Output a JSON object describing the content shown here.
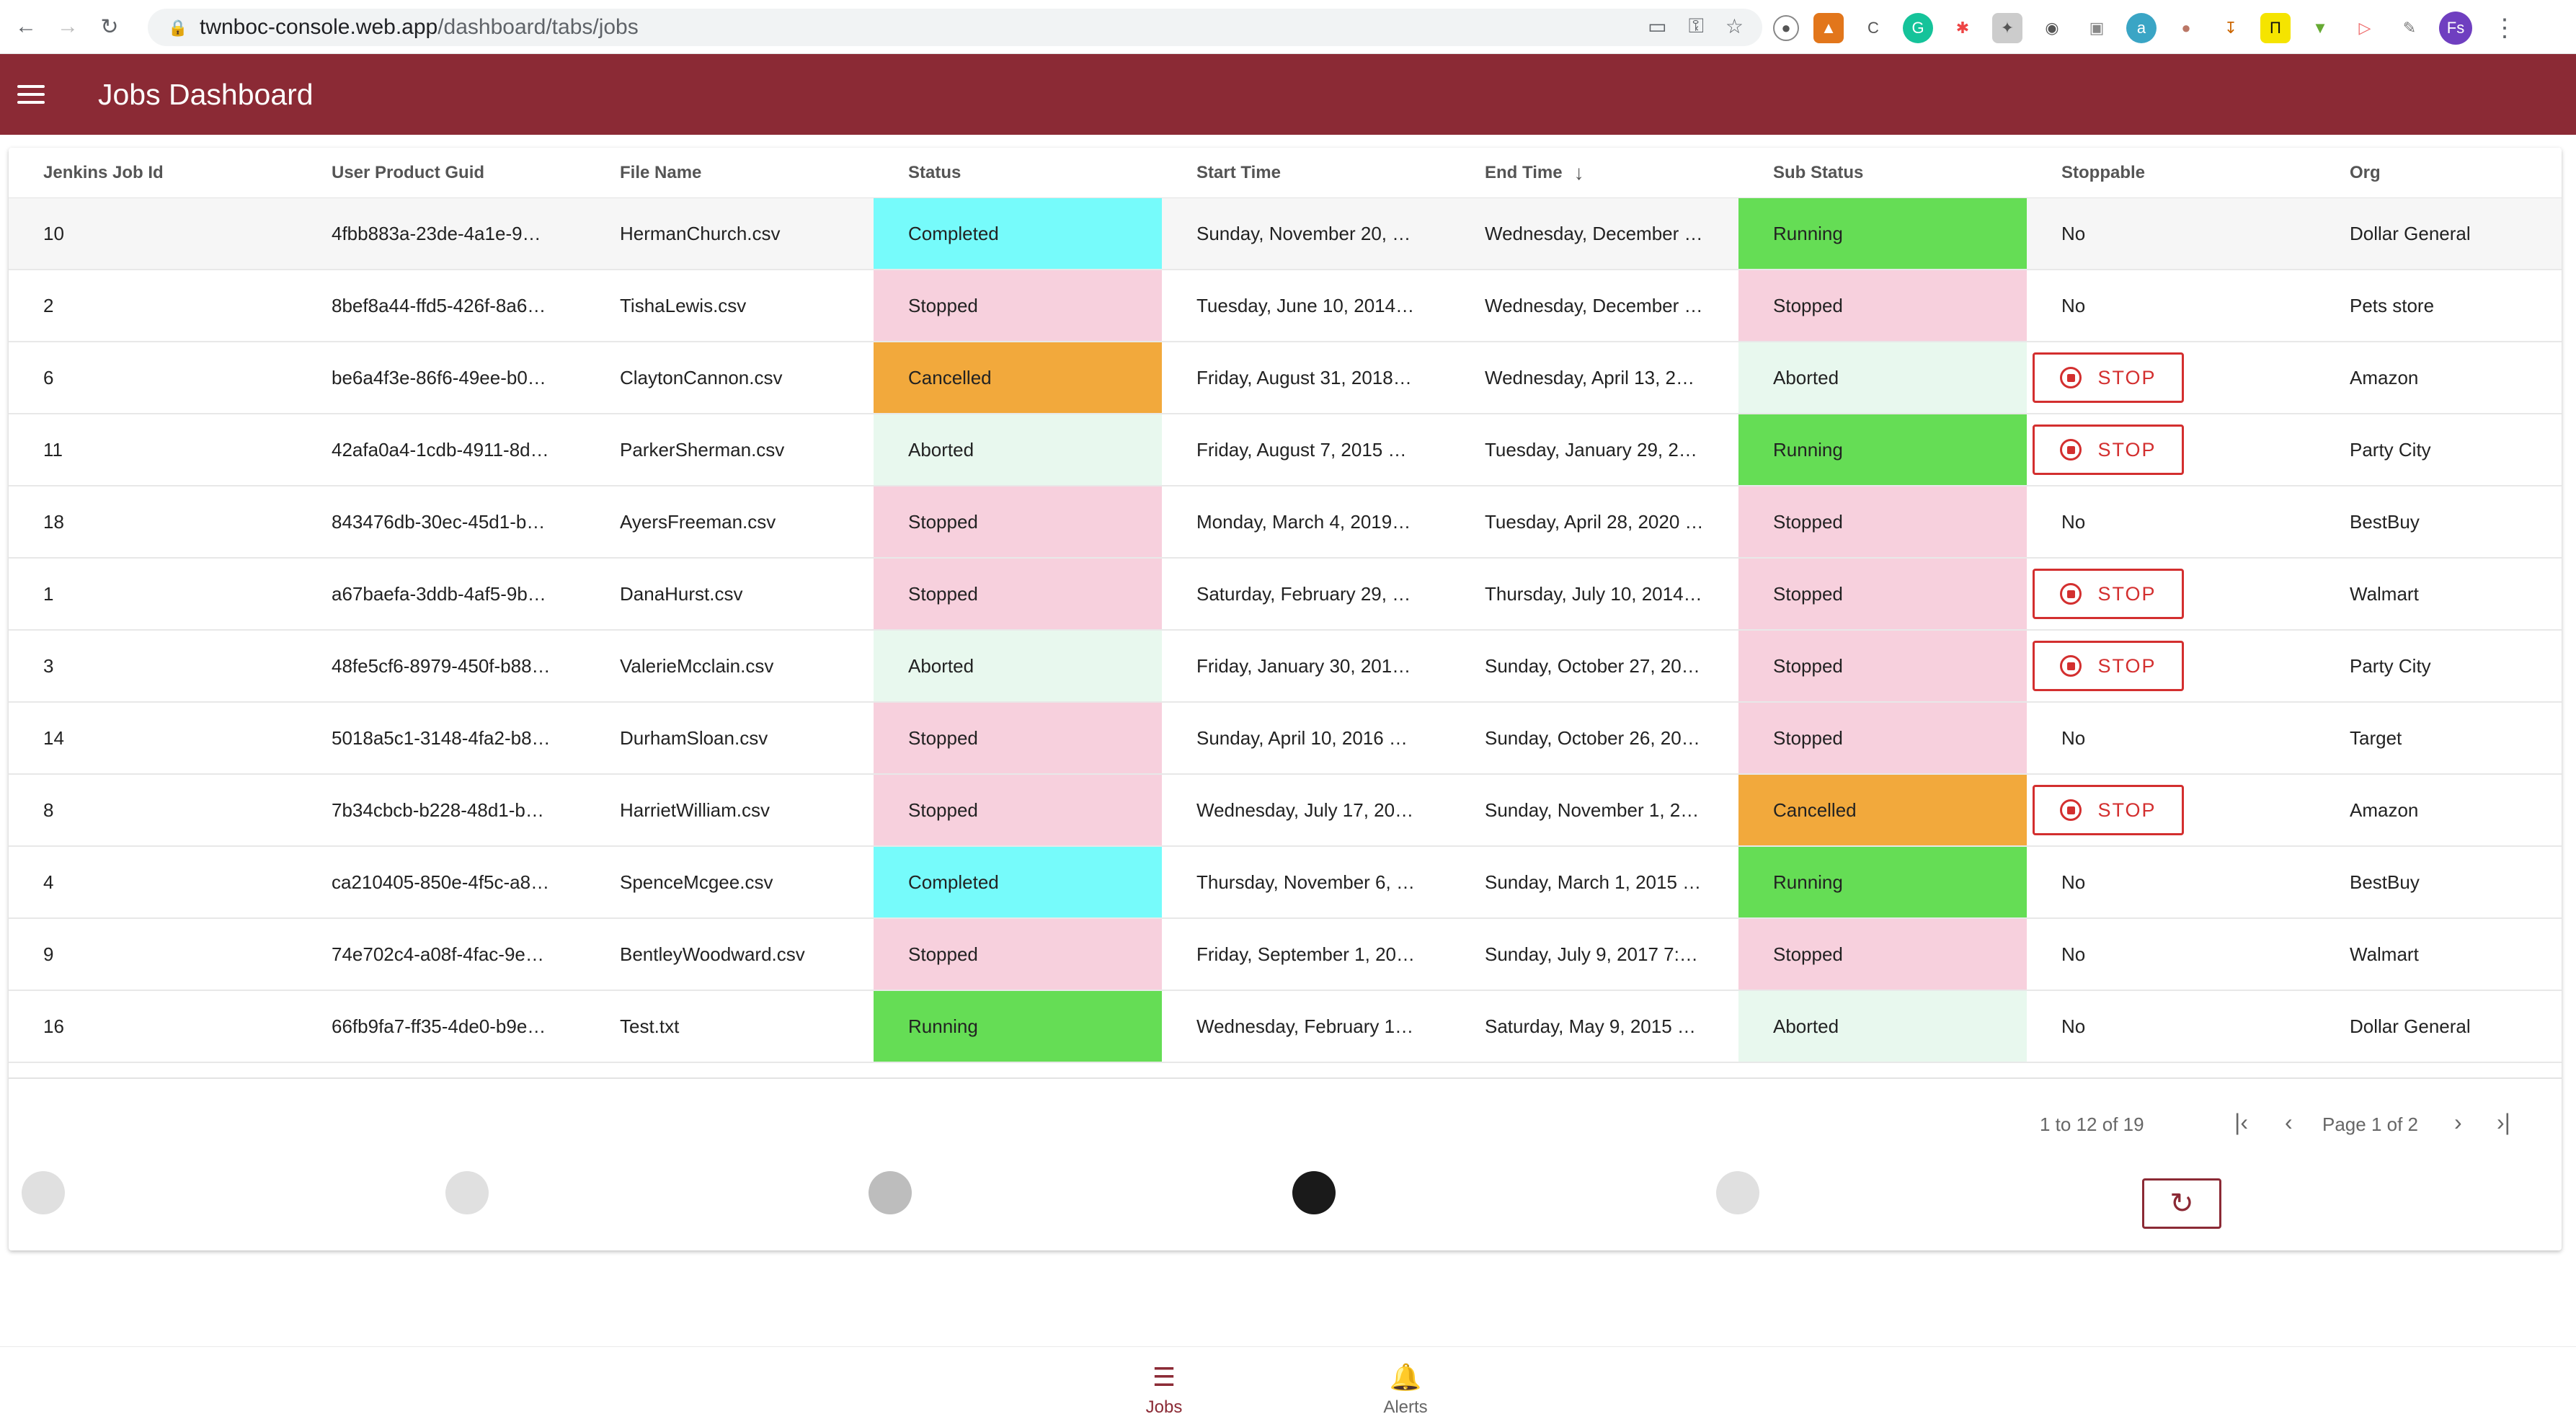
{
  "browser": {
    "url_host": "twnboc-console.web.app",
    "url_path": "/dashboard/tabs/jobs",
    "profile_initials": "Fs"
  },
  "header": {
    "title": "Jobs Dashboard"
  },
  "table": {
    "columns": [
      "Jenkins Job Id",
      "User Product Guid",
      "File Name",
      "Status",
      "Start Time",
      "End Time",
      "Sub Status",
      "Stoppable",
      "Org"
    ],
    "sorted_column": "End Time",
    "stop_label": "STOP",
    "rows": [
      {
        "id": "10",
        "guid": "4fbb883a-23de-4a1e-9…",
        "file": "HermanChurch.csv",
        "status": "Completed",
        "start": "Sunday, November 20, …",
        "end": "Wednesday, December …",
        "sub": "Running",
        "stoppable": "No",
        "org": "Dollar General"
      },
      {
        "id": "2",
        "guid": "8bef8a44-ffd5-426f-8a6…",
        "file": "TishaLewis.csv",
        "status": "Stopped",
        "start": "Tuesday, June 10, 2014…",
        "end": "Wednesday, December …",
        "sub": "Stopped",
        "stoppable": "No",
        "org": "Pets store"
      },
      {
        "id": "6",
        "guid": "be6a4f3e-86f6-49ee-b0…",
        "file": "ClaytonCannon.csv",
        "status": "Cancelled",
        "start": "Friday, August 31, 2018…",
        "end": "Wednesday, April 13, 2…",
        "sub": "Aborted",
        "stoppable": "STOP",
        "org": "Amazon"
      },
      {
        "id": "11",
        "guid": "42afa0a4-1cdb-4911-8d…",
        "file": "ParkerSherman.csv",
        "status": "Aborted",
        "start": "Friday, August 7, 2015 …",
        "end": "Tuesday, January 29, 2…",
        "sub": "Running",
        "stoppable": "STOP",
        "org": "Party City"
      },
      {
        "id": "18",
        "guid": "843476db-30ec-45d1-b…",
        "file": "AyersFreeman.csv",
        "status": "Stopped",
        "start": "Monday, March 4, 2019…",
        "end": "Tuesday, April 28, 2020 …",
        "sub": "Stopped",
        "stoppable": "No",
        "org": "BestBuy"
      },
      {
        "id": "1",
        "guid": "a67baefa-3ddb-4af5-9b…",
        "file": "DanaHurst.csv",
        "status": "Stopped",
        "start": "Saturday, February 29, …",
        "end": "Thursday, July 10, 2014…",
        "sub": "Stopped",
        "stoppable": "STOP",
        "org": "Walmart"
      },
      {
        "id": "3",
        "guid": "48fe5cf6-8979-450f-b88…",
        "file": "ValerieMcclain.csv",
        "status": "Aborted",
        "start": "Friday, January 30, 201…",
        "end": "Sunday, October 27, 20…",
        "sub": "Stopped",
        "stoppable": "STOP",
        "org": "Party City"
      },
      {
        "id": "14",
        "guid": "5018a5c1-3148-4fa2-b8…",
        "file": "DurhamSloan.csv",
        "status": "Stopped",
        "start": "Sunday, April 10, 2016 …",
        "end": "Sunday, October 26, 20…",
        "sub": "Stopped",
        "stoppable": "No",
        "org": "Target"
      },
      {
        "id": "8",
        "guid": "7b34cbcb-b228-48d1-b…",
        "file": "HarrietWilliam.csv",
        "status": "Stopped",
        "start": "Wednesday, July 17, 20…",
        "end": "Sunday, November 1, 2…",
        "sub": "Cancelled",
        "stoppable": "STOP",
        "org": "Amazon"
      },
      {
        "id": "4",
        "guid": "ca210405-850e-4f5c-a8…",
        "file": "SpenceMcgee.csv",
        "status": "Completed",
        "start": "Thursday, November 6, …",
        "end": "Sunday, March 1, 2015 …",
        "sub": "Running",
        "stoppable": "No",
        "org": "BestBuy"
      },
      {
        "id": "9",
        "guid": "74e702c4-a08f-4fac-9e…",
        "file": "BentleyWoodward.csv",
        "status": "Stopped",
        "start": "Friday, September 1, 20…",
        "end": "Sunday, July 9, 2017 7:…",
        "sub": "Stopped",
        "stoppable": "No",
        "org": "Walmart"
      },
      {
        "id": "16",
        "guid": "66fb9fa7-ff35-4de0-b9e…",
        "file": "Test.txt",
        "status": "Running",
        "start": "Wednesday, February 1…",
        "end": "Saturday, May 9, 2015 …",
        "sub": "Aborted",
        "stoppable": "No",
        "org": "Dollar General"
      }
    ]
  },
  "pagination": {
    "range": "1 to 12 of 19",
    "page_info": "Page 1 of 2"
  },
  "status_colors": {
    "Completed": "#76fbfb",
    "Stopped": "#f7d0dd",
    "Cancelled": "#f2a93c",
    "Aborted": "#e8f8ee",
    "Running": "#65dd55"
  },
  "bottom_nav": {
    "jobs_label": "Jobs",
    "alerts_label": "Alerts"
  }
}
